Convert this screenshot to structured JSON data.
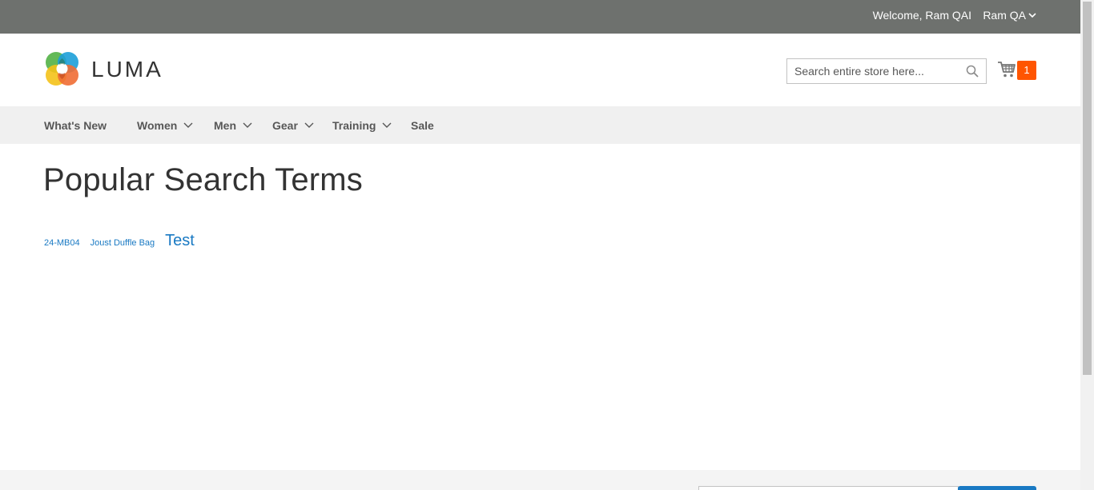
{
  "header": {
    "welcome": "Welcome, Ram QAI",
    "account_name": "Ram QA",
    "logo_text": "LUMA",
    "search_placeholder": "Search entire store here...",
    "cart_count": "1"
  },
  "nav": {
    "items": [
      {
        "label": "What's New"
      },
      {
        "label": "Women"
      },
      {
        "label": "Men"
      },
      {
        "label": "Gear"
      },
      {
        "label": "Training"
      },
      {
        "label": "Sale"
      }
    ]
  },
  "main": {
    "title": "Popular Search Terms",
    "terms": [
      {
        "label": "24-MB04"
      },
      {
        "label": "Joust Duffle Bag"
      },
      {
        "label": "Test"
      }
    ]
  },
  "colors": {
    "topbar": "#6e716e",
    "accent": "#1979c3",
    "cart_badge": "#ff5501"
  }
}
